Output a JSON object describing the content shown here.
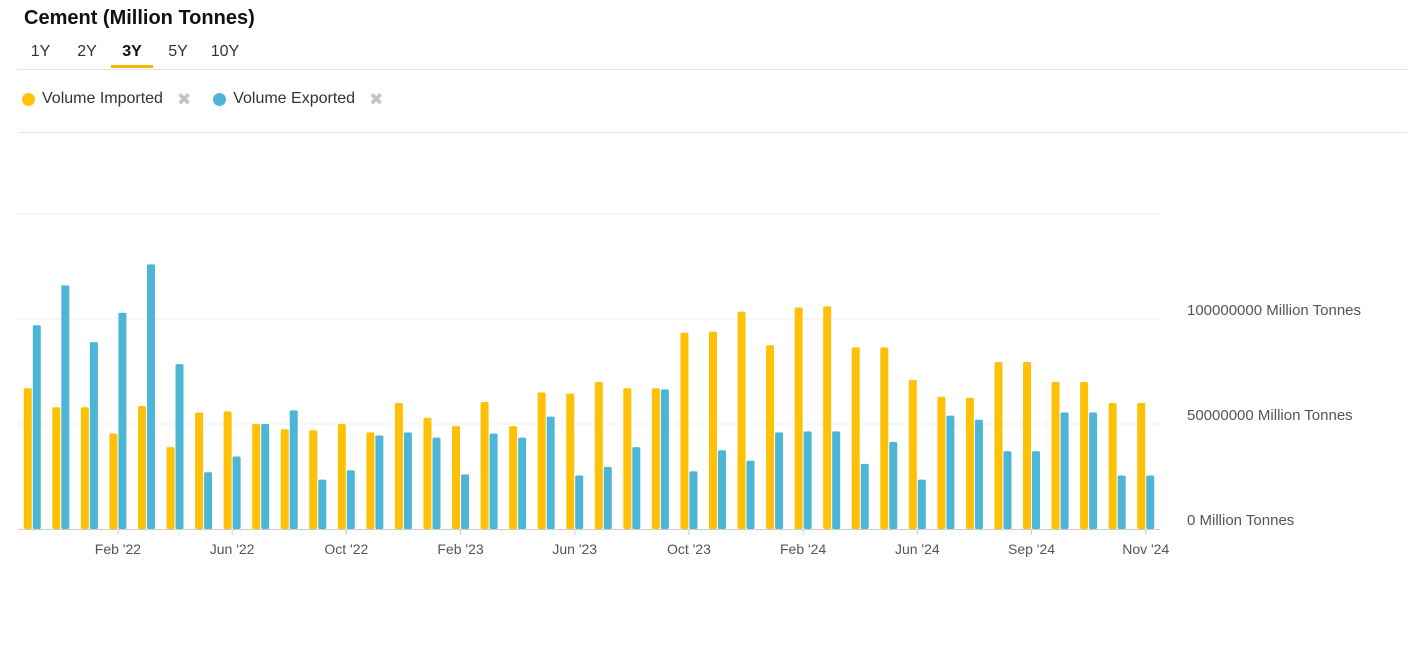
{
  "title": "Cement (Million Tonnes)",
  "tabs": [
    {
      "label": "1Y",
      "active": false
    },
    {
      "label": "2Y",
      "active": false
    },
    {
      "label": "3Y",
      "active": true
    },
    {
      "label": "5Y",
      "active": false
    },
    {
      "label": "10Y",
      "active": false
    }
  ],
  "legend": {
    "items": [
      {
        "label": "Volume Imported",
        "color": "#FFC107",
        "remove_icon": "close-icon"
      },
      {
        "label": "Volume Exported",
        "color": "#4DB6D6",
        "remove_icon": "close-icon"
      }
    ]
  },
  "chart_data": {
    "type": "bar",
    "y_unit": "Million Tonnes",
    "ylim": [
      0,
      150000000
    ],
    "yticks": [
      {
        "value": 0,
        "label": "0 Million Tonnes"
      },
      {
        "value": 50000000,
        "label": "50000000 Million Tonnes"
      },
      {
        "value": 100000000,
        "label": "100000000 Million Tonnes"
      }
    ],
    "x_tick_labels": [
      {
        "index": 3,
        "label": "Feb '22"
      },
      {
        "index": 7,
        "label": "Jun '22"
      },
      {
        "index": 11,
        "label": "Oct '22"
      },
      {
        "index": 15,
        "label": "Feb '23"
      },
      {
        "index": 19,
        "label": "Jun '23"
      },
      {
        "index": 23,
        "label": "Oct '23"
      },
      {
        "index": 27,
        "label": "Feb '24"
      },
      {
        "index": 31,
        "label": "Jun '24"
      },
      {
        "index": 35,
        "label": "Sep '24"
      },
      {
        "index": 39,
        "label": "Nov '24"
      }
    ],
    "grid": true,
    "legend_position": "top-left",
    "series": [
      {
        "name": "Volume Imported",
        "color": "#FFC107",
        "values": [
          67000000,
          58000000,
          58000000,
          45500000,
          58500000,
          39000000,
          55500000,
          56000000,
          50000000,
          47500000,
          47000000,
          50000000,
          46000000,
          60000000,
          53000000,
          49000000,
          60500000,
          49000000,
          65000000,
          64500000,
          70000000,
          67000000,
          67000000,
          93500000,
          94000000,
          103500000,
          87500000,
          105500000,
          106000000,
          86500000,
          86500000,
          71000000,
          63000000,
          62500000,
          79500000,
          79500000,
          70000000,
          70000000,
          60000000,
          60000000
        ]
      },
      {
        "name": "Volume Exported",
        "color": "#4DB6D6",
        "values": [
          97000000,
          116000000,
          89000000,
          103000000,
          126000000,
          78500000,
          27000000,
          34500000,
          50000000,
          56500000,
          23500000,
          28000000,
          44500000,
          46000000,
          43500000,
          26000000,
          45500000,
          43500000,
          53500000,
          25500000,
          29500000,
          39000000,
          66500000,
          27500000,
          37500000,
          32500000,
          46000000,
          46500000,
          46500000,
          31000000,
          41500000,
          23500000,
          54000000,
          52000000,
          37000000,
          37000000,
          55500000,
          55500000,
          25500000,
          25500000
        ]
      }
    ]
  }
}
